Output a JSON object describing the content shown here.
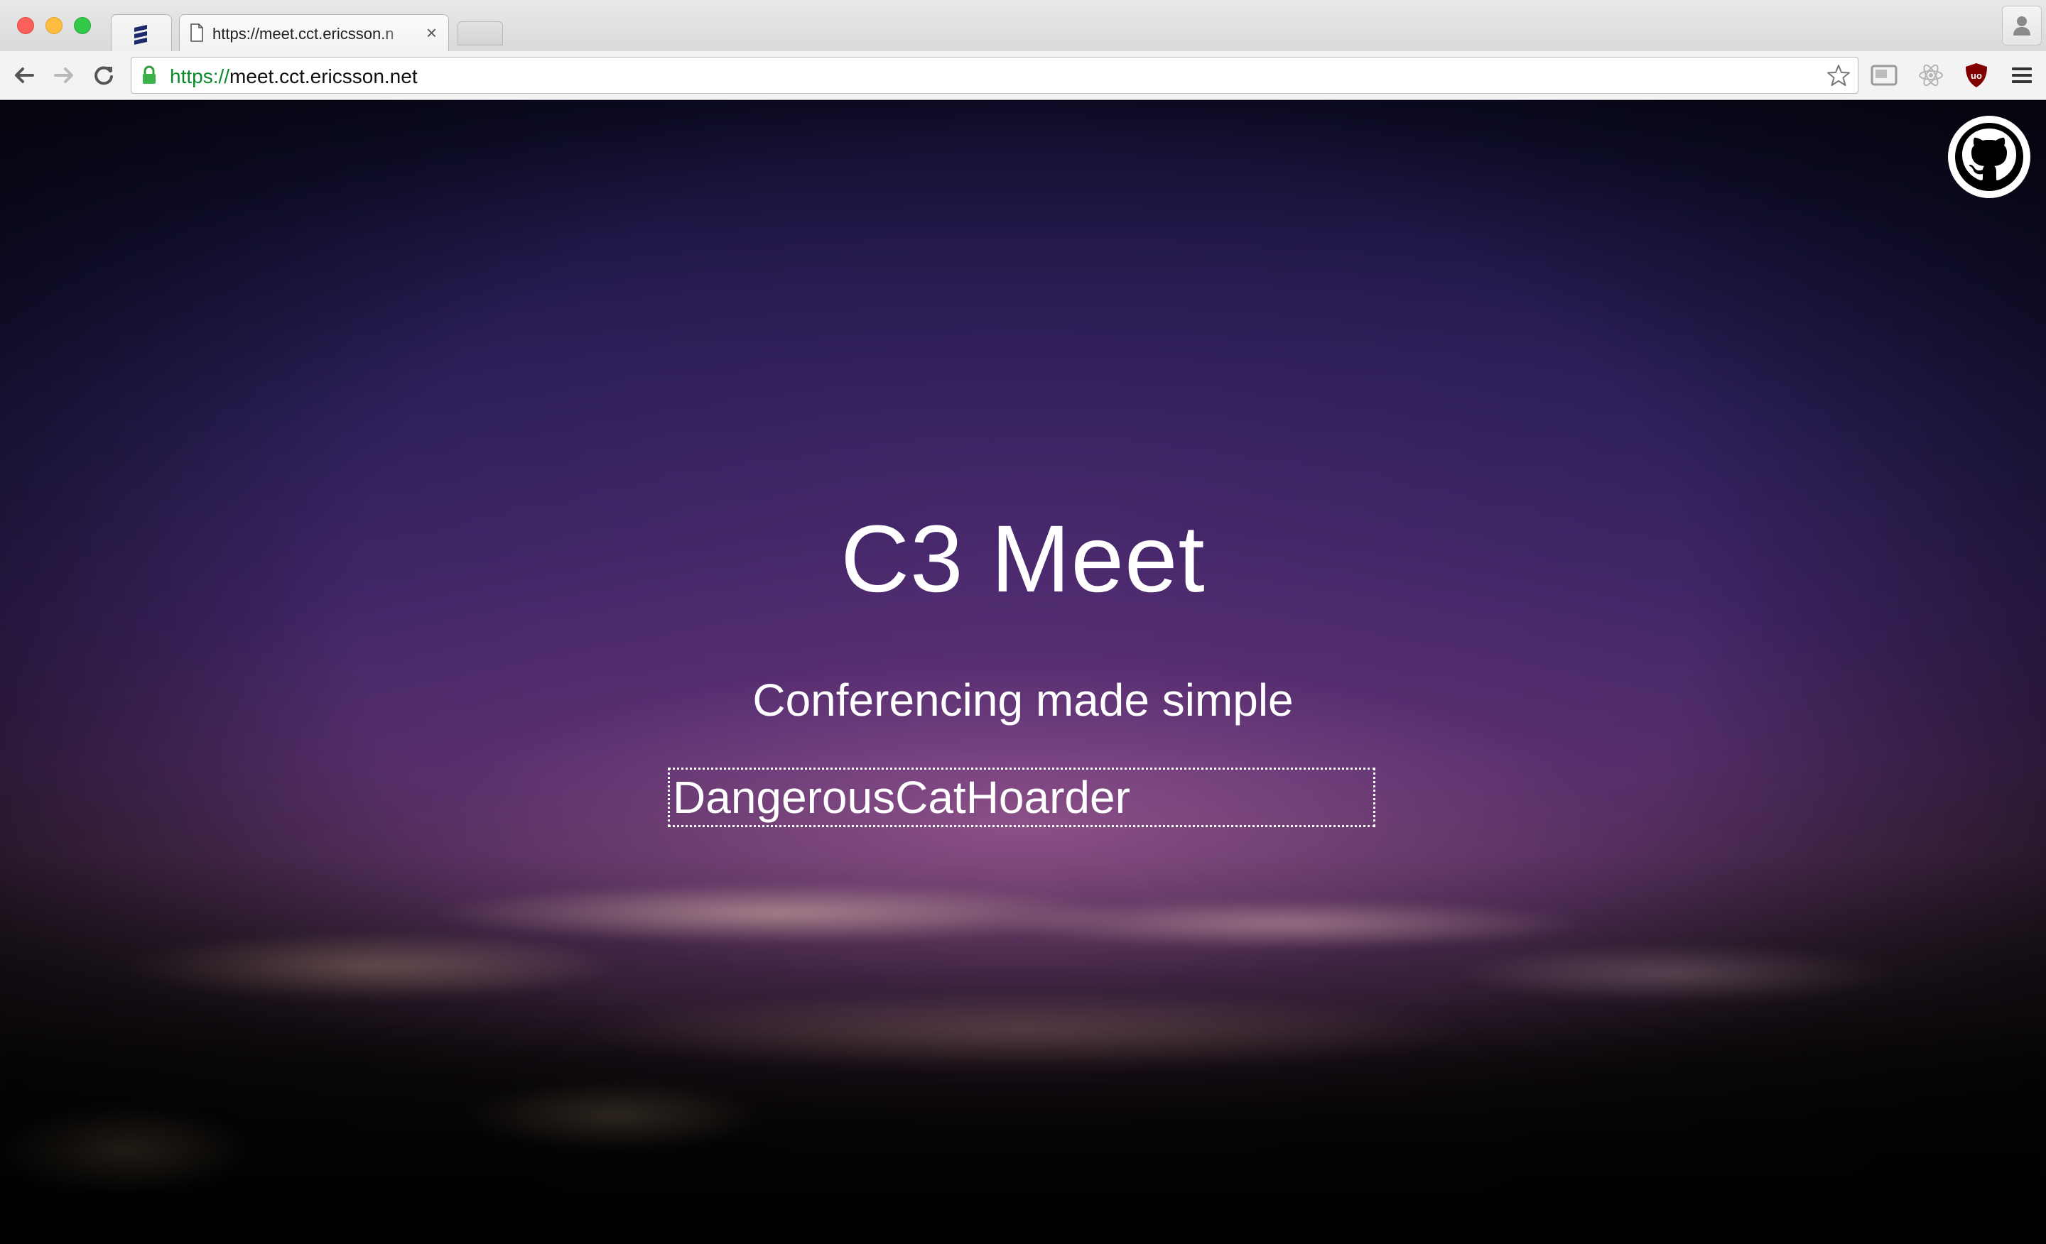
{
  "tabs": {
    "pinned_icon": "stacked-lines-icon",
    "active_title": "https://meet.cct.ericsson.n",
    "close_glyph": "×"
  },
  "toolbar": {
    "url_scheme": "https://",
    "url_rest": "meet.cct.ericsson.net",
    "icons": [
      "back-arrow-icon",
      "forward-arrow-icon",
      "reload-icon",
      "lock-icon",
      "star-icon",
      "cast-icon",
      "react-icon",
      "ublock-icon",
      "hamburger-menu-icon"
    ]
  },
  "page": {
    "title": "C3 Meet",
    "subtitle": "Conferencing made simple",
    "room_input_value": "DangerousCatHoarder",
    "corner_icon": "github-octocat-icon"
  },
  "colors": {
    "url_scheme": "#0b8a2c",
    "ublock_badge": "#800000",
    "sky_top": "#0c0b24",
    "sky_mid": "#3a2463",
    "horizon_glow": "#be6eaa"
  }
}
